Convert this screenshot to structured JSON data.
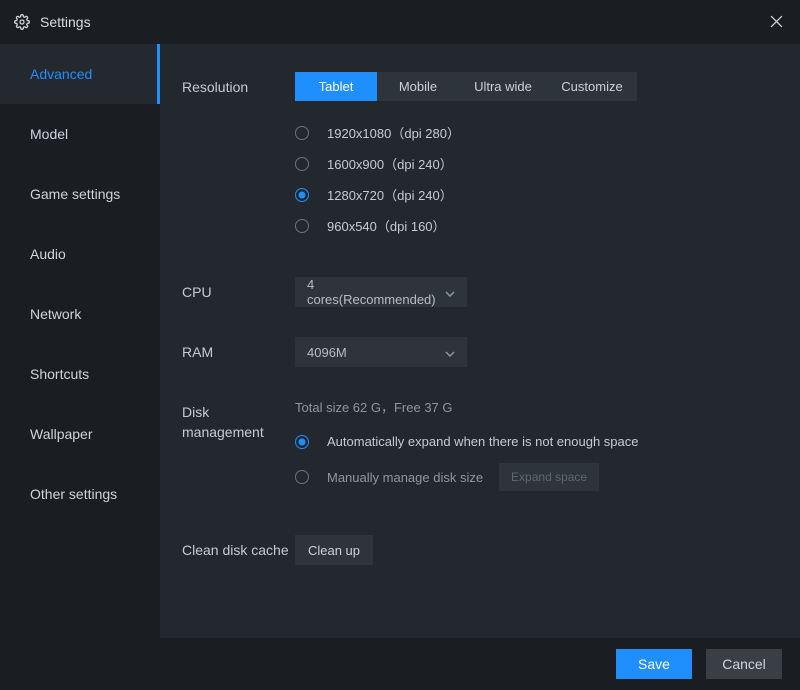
{
  "titlebar": {
    "title": "Settings"
  },
  "sidebar": {
    "items": [
      {
        "label": "Advanced"
      },
      {
        "label": "Model"
      },
      {
        "label": "Game settings"
      },
      {
        "label": "Audio"
      },
      {
        "label": "Network"
      },
      {
        "label": "Shortcuts"
      },
      {
        "label": "Wallpaper"
      },
      {
        "label": "Other settings"
      }
    ],
    "active_index": 0
  },
  "resolution": {
    "label": "Resolution",
    "tabs": [
      {
        "label": "Tablet"
      },
      {
        "label": "Mobile"
      },
      {
        "label": "Ultra wide"
      },
      {
        "label": "Customize"
      }
    ],
    "active_tab": 0,
    "options": [
      {
        "label": "1920x1080（dpi 280）"
      },
      {
        "label": "1600x900（dpi 240）"
      },
      {
        "label": "1280x720（dpi 240）"
      },
      {
        "label": "960x540（dpi 160）"
      }
    ],
    "selected_index": 2
  },
  "cpu": {
    "label": "CPU",
    "value": "4 cores(Recommended)"
  },
  "ram": {
    "label": "RAM",
    "value": "4096M"
  },
  "disk": {
    "label": "Disk\nmanagement",
    "label_l1": "Disk",
    "label_l2": "management",
    "info": "Total size 62 G，Free 37 G",
    "auto_label": "Automatically expand when there is not enough space",
    "manual_label": "Manually manage disk size",
    "expand_button": "Expand space",
    "selected": "auto"
  },
  "clean": {
    "label": "Clean disk cache",
    "button": "Clean up"
  },
  "footer": {
    "save": "Save",
    "cancel": "Cancel"
  }
}
